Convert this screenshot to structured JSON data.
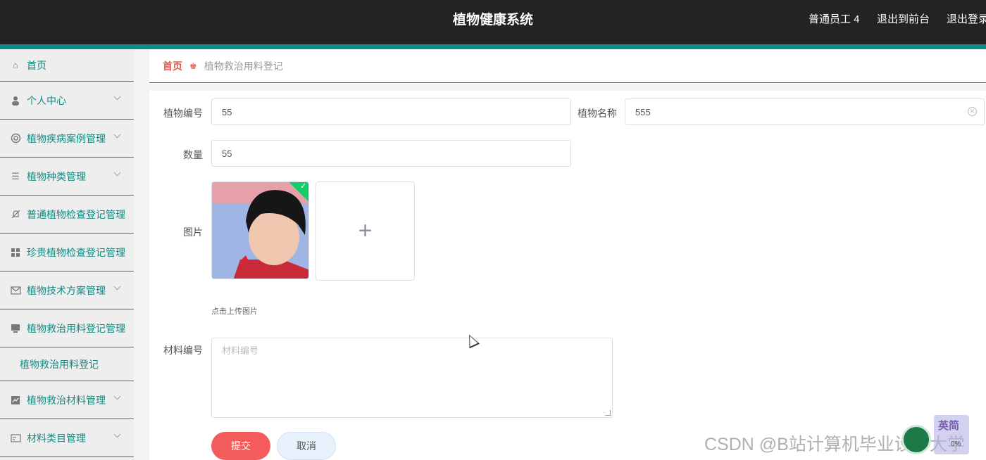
{
  "header": {
    "title": "植物健康系统",
    "user_label": "普通员工 4",
    "exit_front_label": "退出到前台",
    "logout_label": "退出登录"
  },
  "sidebar": {
    "items": [
      {
        "label": "首页",
        "icon": "home-icon"
      },
      {
        "label": "个人中心",
        "icon": "user-icon"
      },
      {
        "label": "植物疾病案例管理",
        "icon": "lifebuoy-icon"
      },
      {
        "label": "植物种类管理",
        "icon": "list-icon"
      },
      {
        "label": "普通植物检查登记管理",
        "icon": "bell-off-icon"
      },
      {
        "label": "珍贵植物检查登记管理",
        "icon": "grid-icon"
      },
      {
        "label": "植物技术方案管理",
        "icon": "mail-icon"
      },
      {
        "label": "植物救治用料登记管理",
        "icon": "monitor-icon"
      },
      {
        "label": "植物救治材料管理",
        "icon": "chart-icon"
      },
      {
        "label": "材料类目管理",
        "icon": "card-icon"
      }
    ],
    "submenu_label": "植物救治用料登记"
  },
  "breadcrumb": {
    "home": "首页",
    "current": "植物救治用料登记"
  },
  "form": {
    "plant_no_label": "植物编号",
    "plant_no_value": "55",
    "plant_name_label": "植物名称",
    "plant_name_value": "555",
    "quantity_label": "数量",
    "quantity_value": "55",
    "image_label": "图片",
    "upload_hint": "点击上传图片",
    "material_no_label": "材料编号",
    "material_no_placeholder": "材料编号",
    "submit_label": "提交",
    "cancel_label": "取消"
  },
  "watermark": "CSDN @B站计算机毕业设计大学",
  "ime": {
    "text": "英简",
    "pct": "0%"
  }
}
